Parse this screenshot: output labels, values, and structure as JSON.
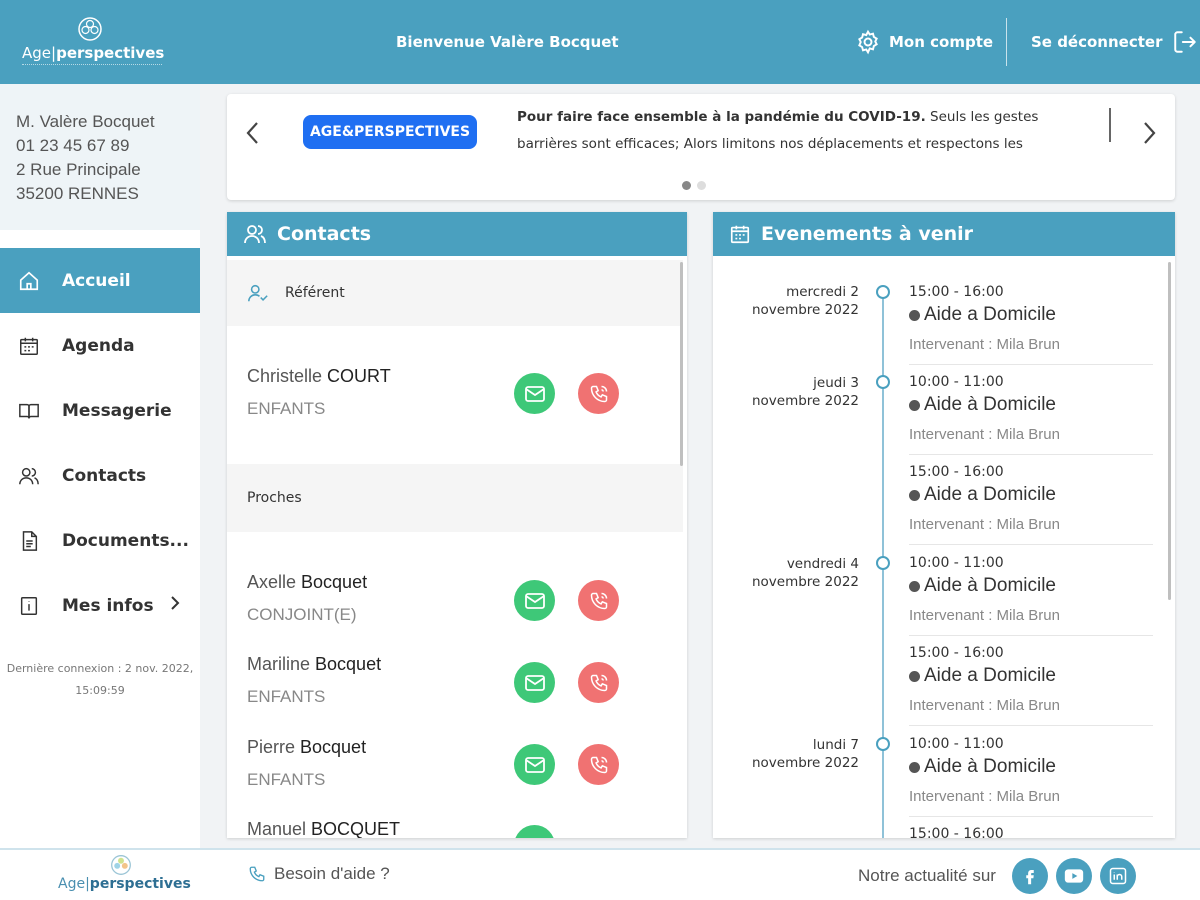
{
  "header": {
    "logo_brand_light": "Age|",
    "logo_brand_bold": "perspectives",
    "welcome": "Bienvenue Valère Bocquet",
    "account_label": "Mon compte",
    "logout_label": "Se déconnecter"
  },
  "profile": {
    "name": "M. Valère Bocquet",
    "phone": "01 23 45 67 89",
    "street": "2 Rue Principale",
    "city": "35200 RENNES"
  },
  "nav": {
    "items": [
      {
        "label": "Accueil",
        "icon": "home-icon"
      },
      {
        "label": "Agenda",
        "icon": "calendar-icon"
      },
      {
        "label": "Messagerie",
        "icon": "book-icon"
      },
      {
        "label": "Contacts",
        "icon": "users-icon"
      },
      {
        "label": "Documents...",
        "icon": "document-icon"
      },
      {
        "label": "Mes infos",
        "icon": "info-icon"
      }
    ],
    "last_connection_line1": "Dernière connexion : 2 nov. 2022,",
    "last_connection_line2": "15:09:59"
  },
  "banner": {
    "badge": "AGE&PERSPECTIVES",
    "headline": "Pour faire face ensemble à la pandémie du COVID-19.",
    "body": "Seuls les gestes barrières sont efficaces; Alors limitons nos déplacements et respectons les"
  },
  "contacts": {
    "title": "Contacts",
    "referent_label": "Référent",
    "proches_label": "Proches",
    "referent": {
      "first": "Christelle ",
      "last": "COURT",
      "relation": "ENFANTS"
    },
    "proches": [
      {
        "first": "Axelle ",
        "last": "Bocquet",
        "relation": "CONJOINT(E)"
      },
      {
        "first": "Mariline ",
        "last": "Bocquet",
        "relation": "ENFANTS"
      },
      {
        "first": "Pierre ",
        "last": "Bocquet",
        "relation": "ENFANTS"
      },
      {
        "first": "Manuel ",
        "last": "BOCQUET",
        "relation": ""
      }
    ]
  },
  "events": {
    "title": "Evenements à venir",
    "days": [
      {
        "line1": "mercredi 2",
        "line2": "novembre 2022"
      },
      {
        "line1": "jeudi 3",
        "line2": "novembre 2022"
      },
      {
        "line1": "vendredi 4",
        "line2": "novembre 2022"
      },
      {
        "line1": "lundi 7",
        "line2": "novembre 2022"
      }
    ],
    "items": [
      {
        "time": "15:00 - 16:00",
        "title": "Aide a Domicile",
        "staff": "Intervenant : Mila Brun"
      },
      {
        "time": "10:00 - 11:00",
        "title": "Aide à Domicile",
        "staff": "Intervenant : Mila Brun"
      },
      {
        "time": "15:00 - 16:00",
        "title": "Aide a Domicile",
        "staff": "Intervenant : Mila Brun"
      },
      {
        "time": "10:00 - 11:00",
        "title": "Aide à Domicile",
        "staff": "Intervenant : Mila Brun"
      },
      {
        "time": "15:00 - 16:00",
        "title": "Aide a Domicile",
        "staff": "Intervenant : Mila Brun"
      },
      {
        "time": "10:00 - 11:00",
        "title": "Aide à Domicile",
        "staff": "Intervenant : Mila Brun"
      },
      {
        "time": "15:00 - 16:00",
        "title": "",
        "staff": ""
      }
    ]
  },
  "footer": {
    "logo_brand_light": "Age|",
    "logo_brand_bold": "perspectives",
    "help_label": "Besoin d'aide ?",
    "news_label": "Notre actualité sur",
    "social": [
      "facebook-icon",
      "youtube-icon",
      "linkedin-icon"
    ]
  },
  "colors": {
    "primary": "#4aa0bf",
    "badge": "#1f6ff2",
    "mail": "#3ec878",
    "call": "#f07272"
  }
}
